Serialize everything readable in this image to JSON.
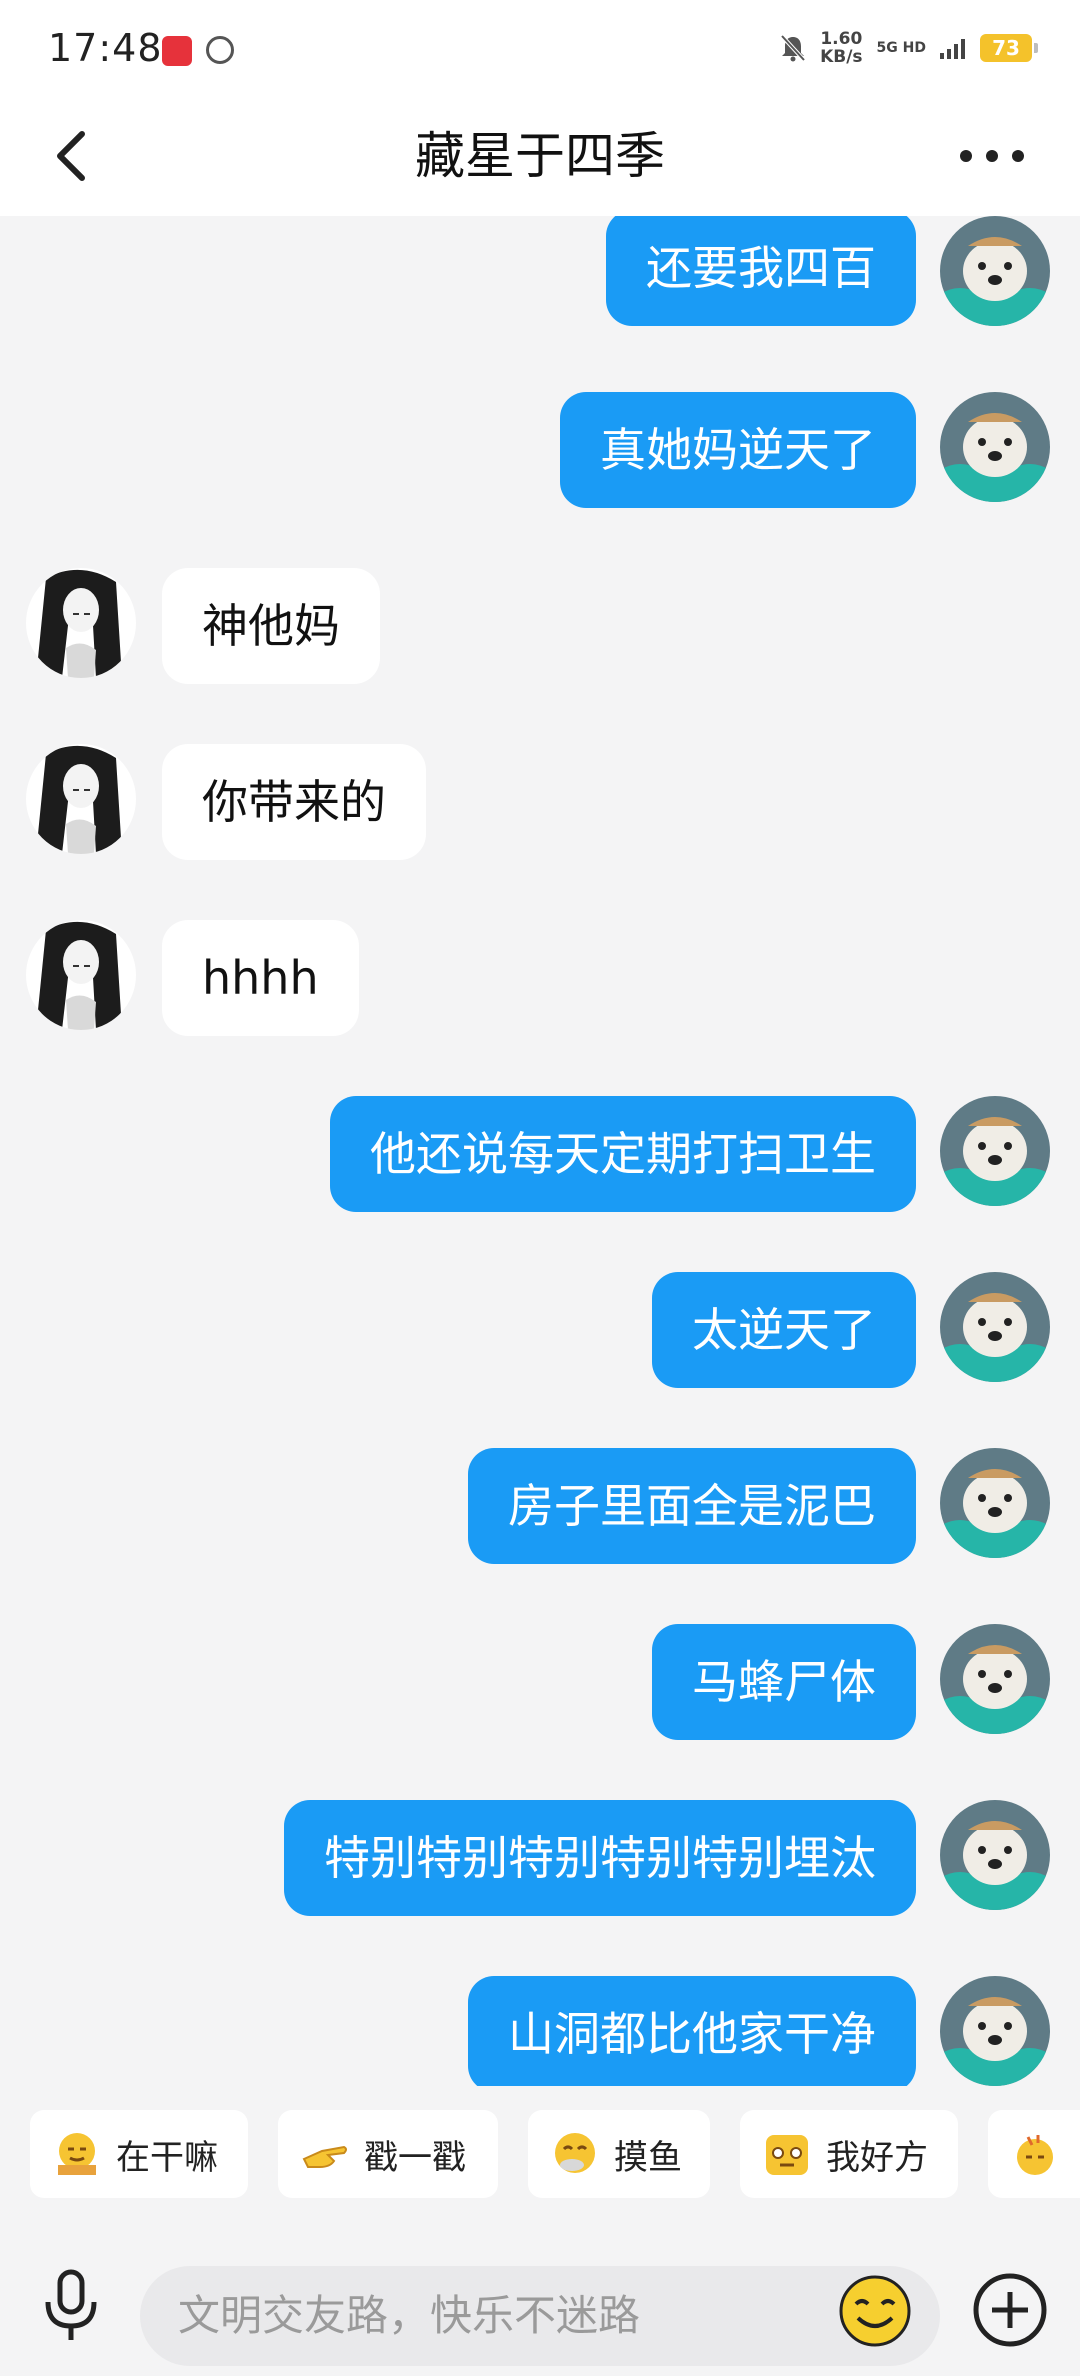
{
  "status_bar": {
    "time": "17:48",
    "speed_value": "1.60",
    "speed_unit": "KB/s",
    "network": "5G HD",
    "battery": "73"
  },
  "header": {
    "title": "藏星于四季"
  },
  "messages": [
    {
      "side": "out",
      "text": "还要我四百"
    },
    {
      "side": "out",
      "text": "真她妈逆天了"
    },
    {
      "side": "in",
      "text": "神他妈"
    },
    {
      "side": "in",
      "text": "你带来的"
    },
    {
      "side": "in",
      "text": "hhhh"
    },
    {
      "side": "out",
      "text": "他还说每天定期打扫卫生"
    },
    {
      "side": "out",
      "text": "太逆天了"
    },
    {
      "side": "out",
      "text": "房子里面全是泥巴"
    },
    {
      "side": "out",
      "text": "马蜂尸体"
    },
    {
      "side": "out",
      "text": "特别特别特别特别特别埋汰"
    },
    {
      "side": "out",
      "text": "山洞都比他家干净"
    }
  ],
  "quick_actions": [
    {
      "label": "在干嘛",
      "icon": "busy-emoji-icon"
    },
    {
      "label": "戳一戳",
      "icon": "poke-hand-icon"
    },
    {
      "label": "摸鱼",
      "icon": "slacking-emoji-icon"
    },
    {
      "label": "我好方",
      "icon": "square-face-icon"
    },
    {
      "label": "",
      "icon": "extra-emoji-icon"
    }
  ],
  "input": {
    "placeholder": "文明交友路，快乐不迷路"
  },
  "colors": {
    "outgoing_bubble": "#1a9bf5",
    "incoming_bubble": "#ffffff",
    "background": "#f4f4f5",
    "battery": "#f4c22b"
  }
}
